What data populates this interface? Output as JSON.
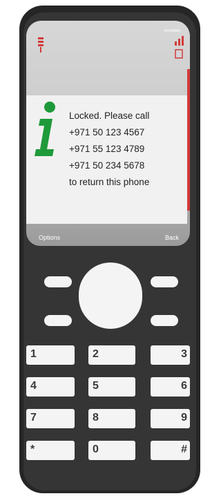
{
  "screen": {
    "carrier": "emirates",
    "message_lines": [
      "Locked. Please call",
      "+971 50 123 4567",
      "+971 55 123 4789",
      "+971 50 234 5678",
      " to return this phone"
    ]
  },
  "softkeys": {
    "left": "Options",
    "right": "Back"
  },
  "keypad": {
    "rows": [
      [
        "1",
        "2",
        "3"
      ],
      [
        "4",
        "5",
        "6"
      ],
      [
        "7",
        "8",
        "9"
      ],
      [
        "*",
        "0",
        "#"
      ]
    ]
  },
  "colors": {
    "info_icon": "#1f9a3a",
    "status_red": "#d23b3b",
    "body": "#262626"
  }
}
